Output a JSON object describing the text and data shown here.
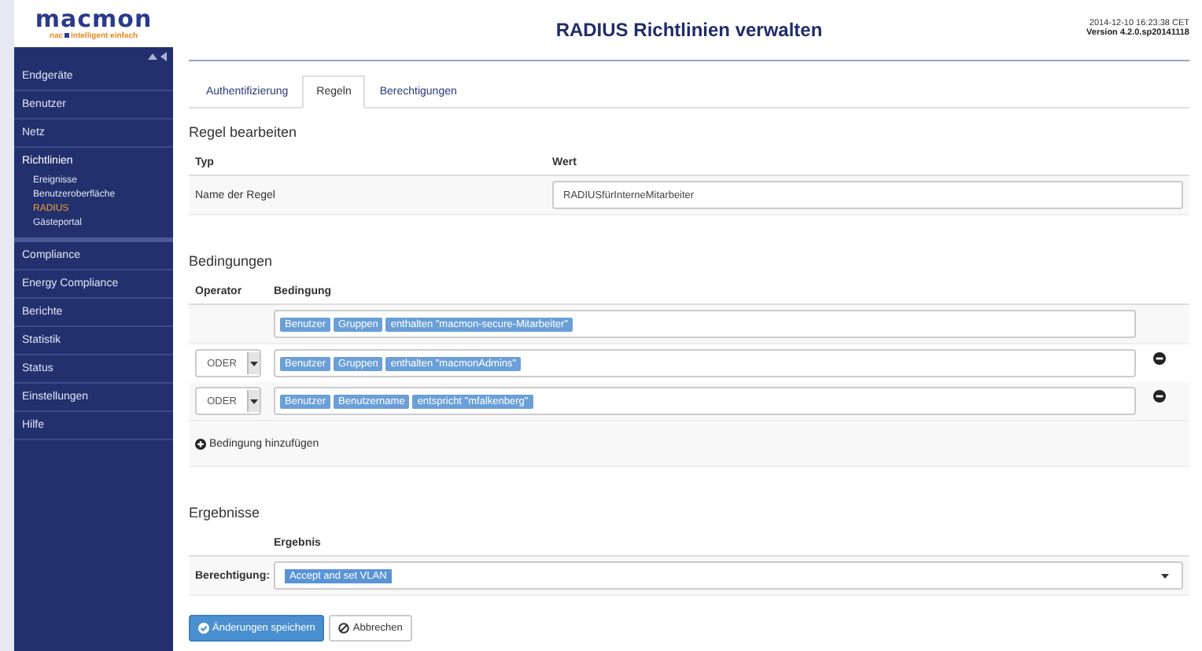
{
  "sidebar": {
    "logo": {
      "name": "macmon",
      "tagline_left": "nac",
      "tagline_right": "intelligent einfach"
    },
    "items": [
      {
        "label": "Endgeräte",
        "selected": false
      },
      {
        "label": "Benutzer",
        "selected": false
      },
      {
        "label": "Netz",
        "selected": false
      },
      {
        "label": "Richtlinien",
        "selected": false,
        "expanded": true,
        "children": [
          {
            "label": "Ereignisse",
            "selected": false
          },
          {
            "label": "Benutzeroberfläche",
            "selected": false
          },
          {
            "label": "RADIUS",
            "selected": true
          },
          {
            "label": "Gästeportal",
            "selected": false
          }
        ]
      },
      {
        "label": "Compliance",
        "selected": false
      },
      {
        "label": "Energy Compliance",
        "selected": false
      },
      {
        "label": "Berichte",
        "selected": false
      },
      {
        "label": "Statistik",
        "selected": false
      },
      {
        "label": "Status",
        "selected": false
      },
      {
        "label": "Einstellungen",
        "selected": false
      },
      {
        "label": "Hilfe",
        "selected": false
      }
    ]
  },
  "header": {
    "title": "RADIUS Richtlinien verwalten",
    "timestamp": "2014-12-10 16:23:38 CET",
    "version": "Version 4.2.0.sp20141118"
  },
  "tabs": [
    {
      "label": "Authentifizierung",
      "selected": false
    },
    {
      "label": "Regeln",
      "selected": true
    },
    {
      "label": "Berechtigungen",
      "selected": false
    }
  ],
  "rule": {
    "title": "Regel bearbeiten",
    "columns": [
      "Typ",
      "Wert"
    ],
    "rows": [
      {
        "label": "Name der Regel",
        "value": "RADIUSfürInterneMitarbeiter"
      }
    ]
  },
  "conditions": {
    "title": "Bedingungen",
    "columns": [
      "Operator",
      "Bedingung"
    ],
    "rows": [
      {
        "tokens": [
          "Benutzer",
          "Gruppen",
          "enthalten \"macmon-secure-Mitarbeiter\""
        ],
        "removable": false
      },
      {
        "operator": "ODER",
        "tokens": [
          "Benutzer",
          "Gruppen",
          "enthalten \"macmonAdmins\""
        ],
        "removable": true
      },
      {
        "operator": "ODER",
        "tokens": [
          "Benutzer",
          "Benutzername",
          "entspricht \"mfalkenberg\""
        ],
        "removable": true
      }
    ],
    "add_label": "Bedingung hinzufügen"
  },
  "results": {
    "title": "Ergebnisse",
    "column": "Ergebnis",
    "rows": [
      {
        "label": "Berechtigung:",
        "value": "Accept and set VLAN"
      }
    ]
  },
  "buttons": [
    {
      "label": "Änderungen speichern",
      "kind": "primary"
    },
    {
      "label": "Abbrechen",
      "kind": "cancel"
    }
  ]
}
